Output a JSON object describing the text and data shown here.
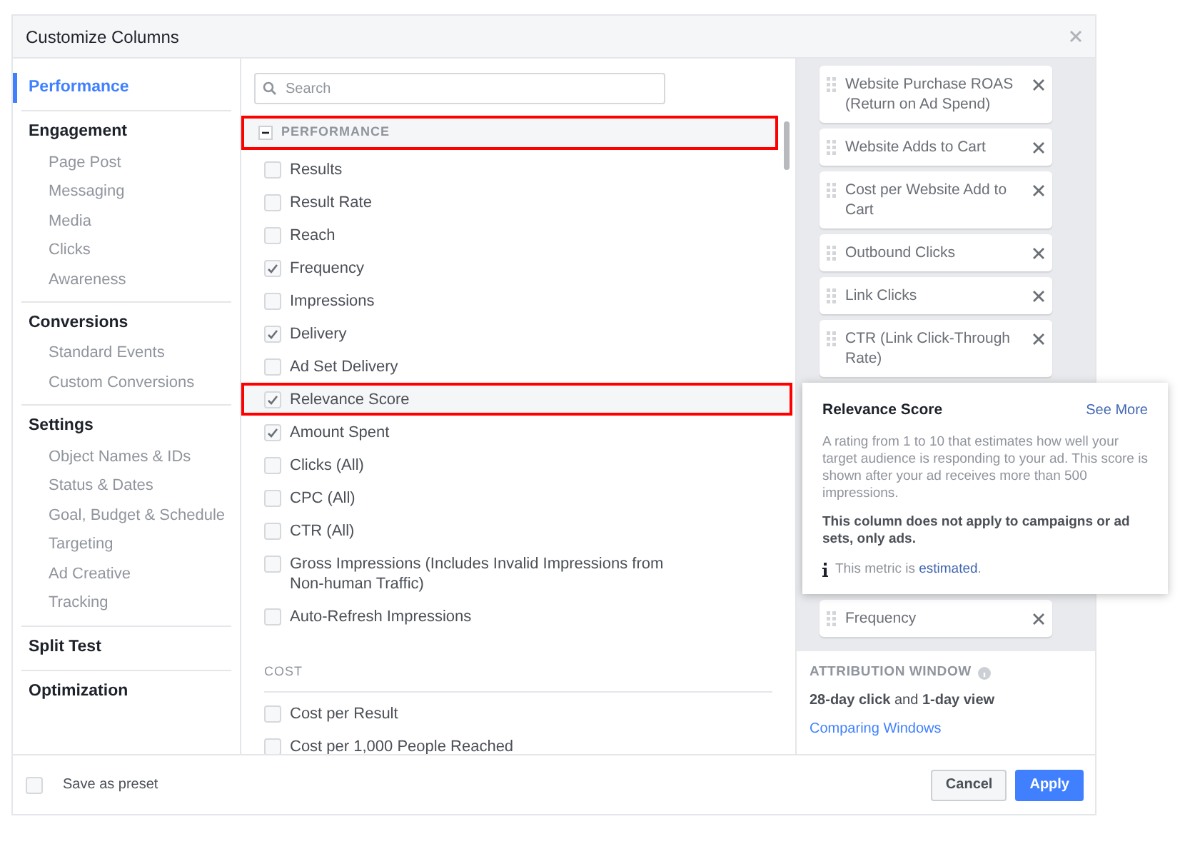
{
  "dialog": {
    "title": "Customize Columns"
  },
  "sidebar": [
    {
      "label": "Performance",
      "selected": true
    },
    {
      "label": "Engagement",
      "selected": false,
      "children": [
        {
          "label": "Page Post",
          "selected": false
        },
        {
          "label": "Messaging",
          "selected": false
        },
        {
          "label": "Media",
          "selected": false
        },
        {
          "label": "Clicks",
          "selected": false
        },
        {
          "label": "Awareness",
          "selected": false
        }
      ]
    },
    {
      "label": "Conversions",
      "selected": false,
      "children": [
        {
          "label": "Standard Events",
          "selected": false
        },
        {
          "label": "Custom Conversions",
          "selected": false
        }
      ]
    },
    {
      "label": "Settings",
      "selected": false,
      "children": [
        {
          "label": "Object Names & IDs",
          "selected": false
        },
        {
          "label": "Status & Dates",
          "selected": false
        },
        {
          "label": "Goal, Budget & Schedule",
          "selected": false
        },
        {
          "label": "Targeting",
          "selected": false
        },
        {
          "label": "Ad Creative",
          "selected": false
        },
        {
          "label": "Tracking",
          "selected": false
        }
      ]
    },
    {
      "label": "Split Test",
      "selected": false
    },
    {
      "label": "Optimization",
      "selected": false
    }
  ],
  "search": {
    "placeholder": "Search"
  },
  "groups": [
    {
      "kind": "expandable",
      "title": "PERFORMANCE",
      "expanded": true,
      "highlighted": true,
      "items": [
        {
          "label": "Results",
          "checked": false,
          "highlighted": false
        },
        {
          "label": "Result Rate",
          "checked": false,
          "highlighted": false
        },
        {
          "label": "Reach",
          "checked": false,
          "highlighted": false
        },
        {
          "label": "Frequency",
          "checked": true,
          "highlighted": false
        },
        {
          "label": "Impressions",
          "checked": false,
          "highlighted": false
        },
        {
          "label": "Delivery",
          "checked": true,
          "highlighted": false
        },
        {
          "label": "Ad Set Delivery",
          "checked": false,
          "highlighted": false
        },
        {
          "label": "Relevance Score",
          "checked": true,
          "highlighted": true
        },
        {
          "label": "Amount Spent",
          "checked": true,
          "highlighted": false
        },
        {
          "label": "Clicks (All)",
          "checked": false,
          "highlighted": false
        },
        {
          "label": "CPC (All)",
          "checked": false,
          "highlighted": false
        },
        {
          "label": "CTR (All)",
          "checked": false,
          "highlighted": false
        },
        {
          "label": "Gross Impressions (Includes Invalid Impressions from Non-human Traffic)",
          "checked": false,
          "highlighted": false
        },
        {
          "label": "Auto-Refresh Impressions",
          "checked": false,
          "highlighted": false
        }
      ]
    },
    {
      "kind": "plain",
      "title": "COST",
      "items": [
        {
          "label": "Cost per Result",
          "checked": false
        },
        {
          "label": "Cost per 1,000 People Reached",
          "checked": false
        }
      ]
    }
  ],
  "selected_columns": [
    {
      "label": "Website Purchase ROAS (Return on Ad Spend)"
    },
    {
      "label": "Website Adds to Cart"
    },
    {
      "label": "Cost per Website Add to Cart"
    },
    {
      "label": "Outbound Clicks"
    },
    {
      "label": "Link Clicks"
    },
    {
      "label": "CTR (Link Click-Through Rate)"
    },
    {
      "label": "Frequency"
    }
  ],
  "tooltip": {
    "title": "Relevance Score",
    "link": "See More",
    "description": "A rating from 1 to 10 that estimates how well your target audience is responding to your ad. This score is shown after your ad receives more than 500 impressions.",
    "note": "This column does not apply to campaigns or ad sets, only ads.",
    "info_prefix": "This metric is ",
    "info_link": "estimated",
    "info_suffix": "."
  },
  "attribution": {
    "title": "ATTRIBUTION WINDOW",
    "value": "**28-day click** and **1-day view**",
    "link": "Comparing Windows"
  },
  "footer": {
    "preset": {
      "label": "Save as preset",
      "checked": false
    },
    "buttons": [
      {
        "label": "Cancel",
        "kind": "secondary"
      },
      {
        "label": "Apply",
        "kind": "primary"
      }
    ]
  }
}
